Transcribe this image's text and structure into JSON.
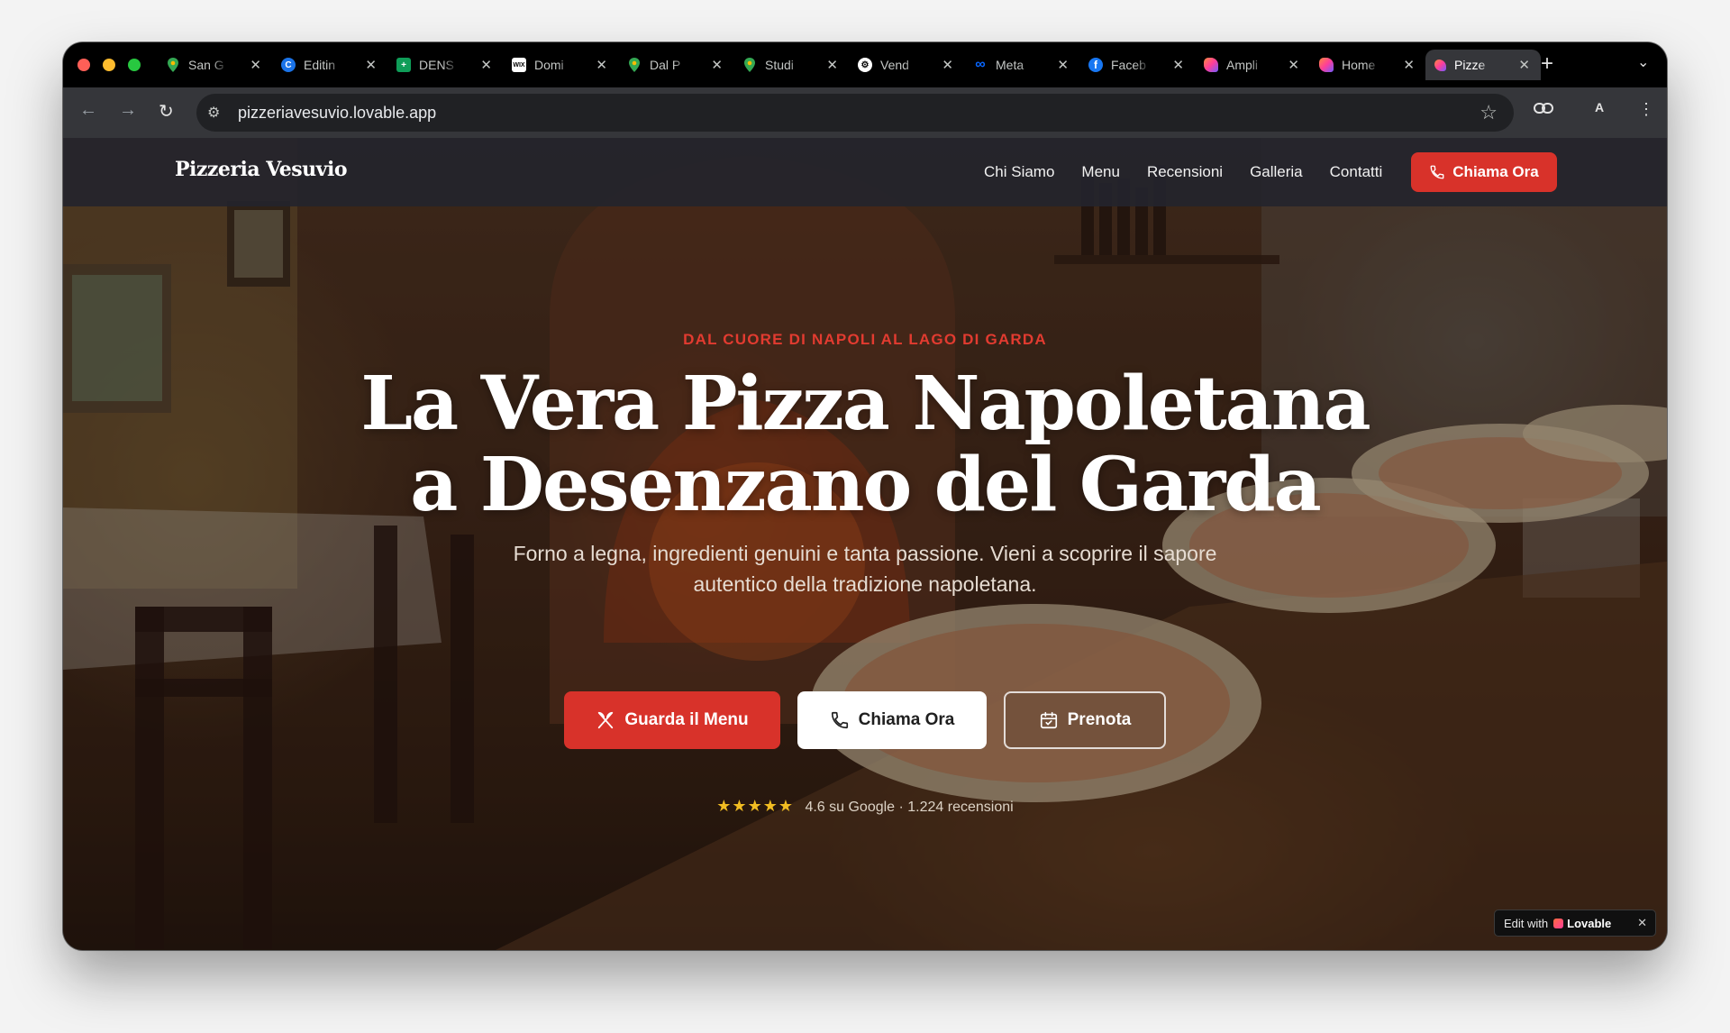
{
  "browser": {
    "tabs": [
      {
        "title": "San G",
        "icon": "maps-pin-icon",
        "color": "#34a853"
      },
      {
        "title": "Editin",
        "icon": "editor-icon",
        "color": "#1a73e8"
      },
      {
        "title": "DENS",
        "icon": "sheets-icon",
        "color": "#0f9d58"
      },
      {
        "title": "Domi",
        "icon": "wix-icon",
        "color": "#ffffff"
      },
      {
        "title": "Dal P",
        "icon": "maps-pin-icon",
        "color": "#34a853"
      },
      {
        "title": "Studi",
        "icon": "maps-pin-icon",
        "color": "#34a853"
      },
      {
        "title": "Vend",
        "icon": "openai-icon",
        "color": "#ffffff"
      },
      {
        "title": "Meta",
        "icon": "meta-icon",
        "color": "#0866ff"
      },
      {
        "title": "Faceb",
        "icon": "facebook-icon",
        "color": "#1877f2"
      },
      {
        "title": "Ampli",
        "icon": "lovable-icon",
        "color": "#ff4d6d"
      },
      {
        "title": "Home",
        "icon": "lovable-icon",
        "color": "#ff4d6d"
      },
      {
        "title": "Pizze",
        "icon": "lovable-icon",
        "color": "#ff4d6d",
        "active": true
      }
    ],
    "url": "pizzeriavesuvio.lovable.app"
  },
  "site": {
    "brand": "Pizzeria Vesuvio",
    "nav": [
      "Chi Siamo",
      "Menu",
      "Recensioni",
      "Galleria",
      "Contatti"
    ],
    "nav_cta": "Chiama Ora",
    "hero": {
      "kicker": "DAL CUORE DI NAPOLI AL LAGO DI GARDA",
      "title_line1": "La Vera Pizza Napoletana",
      "title_line2": "a Desenzano del Garda",
      "subtitle_line1": "Forno a legna, ingredienti genuini e tanta passione. Vieni a scoprire il sapore",
      "subtitle_line2": "autentico della tradizione napoletana.",
      "btn_menu": "Guarda il Menu",
      "btn_call": "Chiama Ora",
      "btn_book": "Prenota",
      "rating_stars": "★★★★★",
      "rating_text": "4.6 su Google · 1.224 recensioni"
    },
    "badge": {
      "prefix": "Edit with",
      "name": "Lovable"
    }
  },
  "colors": {
    "accent": "#d8322a",
    "nav_bg": "#24242c"
  }
}
